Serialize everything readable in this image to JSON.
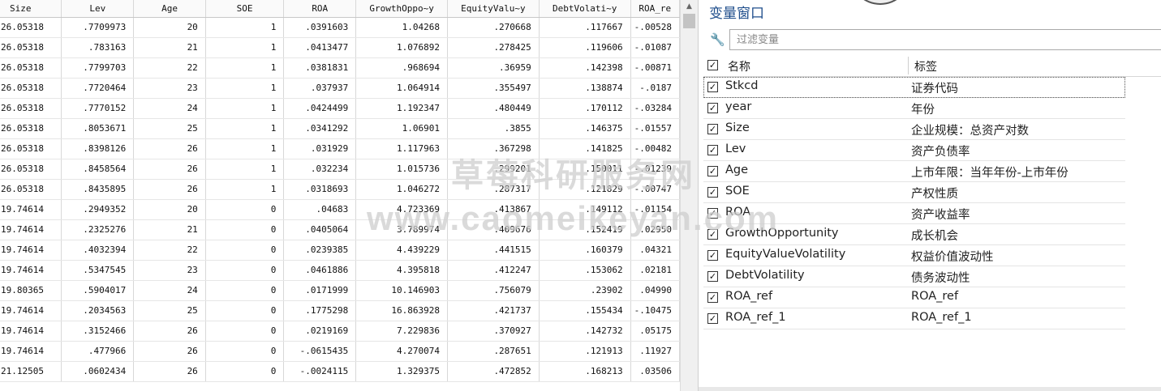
{
  "grid": {
    "columns": [
      "Size",
      "Lev",
      "Age",
      "SOE",
      "ROA",
      "GrowthOppo~y",
      "EquityValu~y",
      "DebtVolati~y",
      "ROA_re"
    ],
    "rows": [
      [
        "26.05318",
        ".7709973",
        "20",
        "1",
        ".0391603",
        "1.04268",
        ".270668",
        ".117667",
        "-.00528"
      ],
      [
        "26.05318",
        ".783163",
        "21",
        "1",
        ".0413477",
        "1.076892",
        ".278425",
        ".119606",
        "-.01087"
      ],
      [
        "26.05318",
        ".7799703",
        "22",
        "1",
        ".0381831",
        ".968694",
        ".36959",
        ".142398",
        "-.00871"
      ],
      [
        "26.05318",
        ".7720464",
        "23",
        "1",
        ".037937",
        "1.064914",
        ".355497",
        ".138874",
        "-.0187"
      ],
      [
        "26.05318",
        ".7770152",
        "24",
        "1",
        ".0424499",
        "1.192347",
        ".480449",
        ".170112",
        "-.03284"
      ],
      [
        "26.05318",
        ".8053671",
        "25",
        "1",
        ".0341292",
        "1.06901",
        ".3855",
        ".146375",
        "-.01557"
      ],
      [
        "26.05318",
        ".8398126",
        "26",
        "1",
        ".031929",
        "1.117963",
        ".367298",
        ".141825",
        "-.00482"
      ],
      [
        "26.05318",
        ".8458564",
        "26",
        "1",
        ".032234",
        "1.015736",
        ".299201",
        ".150011",
        "-.01239"
      ],
      [
        "26.05318",
        ".8435895",
        "26",
        "1",
        ".0318693",
        "1.046272",
        ".287317",
        ".121829",
        "-.00747"
      ],
      [
        "19.74614",
        ".2949352",
        "20",
        "0",
        ".04683",
        "4.723369",
        ".413867",
        ".149112",
        "-.01154"
      ],
      [
        "19.74614",
        ".2325276",
        "21",
        "0",
        ".0405064",
        "3.789974",
        ".409676",
        ".152419",
        ".02950"
      ],
      [
        "19.74614",
        ".4032394",
        "22",
        "0",
        ".0239385",
        "4.439229",
        ".441515",
        ".160379",
        ".04321"
      ],
      [
        "19.74614",
        ".5347545",
        "23",
        "0",
        ".0461886",
        "4.395818",
        ".412247",
        ".153062",
        ".02181"
      ],
      [
        "19.80365",
        ".5904017",
        "24",
        "0",
        ".0171999",
        "10.146903",
        ".756079",
        ".23902",
        ".04990"
      ],
      [
        "19.74614",
        ".2034563",
        "25",
        "0",
        ".1775298",
        "16.863928",
        ".421737",
        ".155434",
        "-.10475"
      ],
      [
        "19.74614",
        ".3152466",
        "26",
        "0",
        ".0219169",
        "7.229836",
        ".370927",
        ".142732",
        ".05175"
      ],
      [
        "19.74614",
        ".477966",
        "26",
        "0",
        "-.0615435",
        "4.270074",
        ".287651",
        ".121913",
        ".11927"
      ],
      [
        "21.12505",
        ".0602434",
        "26",
        "0",
        "-.0024115",
        "1.329375",
        ".472852",
        ".168213",
        ".03506"
      ]
    ]
  },
  "panel": {
    "title": "变量窗口",
    "filter_placeholder": "过滤变量",
    "header_name": "名称",
    "header_label": "标签",
    "variables": [
      {
        "name": "Stkcd",
        "label": "证券代码",
        "checked": true
      },
      {
        "name": "year",
        "label": "年份",
        "checked": true
      },
      {
        "name": "Size",
        "label": "企业规模：总资产对数",
        "checked": true
      },
      {
        "name": "Lev",
        "label": "资产负债率",
        "checked": true
      },
      {
        "name": "Age",
        "label": "上市年限：当年年份-上市年份",
        "checked": true
      },
      {
        "name": "SOE",
        "label": "产权性质",
        "checked": true
      },
      {
        "name": "ROA",
        "label": "资产收益率",
        "checked": true
      },
      {
        "name": "GrowthOpportunity",
        "label": "成长机会",
        "checked": true
      },
      {
        "name": "EquityValueVolatility",
        "label": "权益价值波动性",
        "checked": true
      },
      {
        "name": "DebtVolatility",
        "label": "债务波动性",
        "checked": true
      },
      {
        "name": "ROA_ref",
        "label": "ROA_ref",
        "checked": true
      },
      {
        "name": "ROA_ref_1",
        "label": "ROA_ref_1",
        "checked": true
      }
    ]
  },
  "watermark": {
    "line1": "草莓科研服务网",
    "line2": "www.caomeikeyan.com"
  },
  "icons": {
    "filter": "wrench-icon",
    "check": "checkbox-checked-icon",
    "scroll_up": "scroll-up-arrow-icon"
  }
}
